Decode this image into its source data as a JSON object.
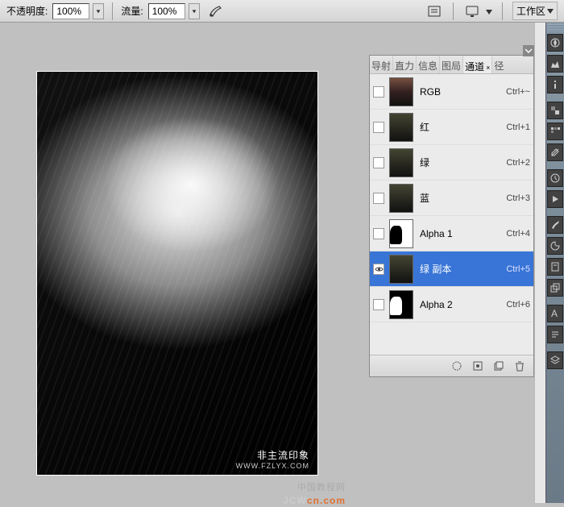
{
  "toolbar": {
    "opacity_label": "不透明度:",
    "opacity_value": "100%",
    "flow_label": "流量:",
    "flow_value": "100%",
    "workspace_label": "工作区"
  },
  "watermark": {
    "main": "非主流印象",
    "sub": "WWW.FZLYX.COM",
    "site_prefix": "中国教程网",
    "site1": "JCW",
    "site2": "cn",
    "site3": ".com"
  },
  "panel": {
    "tabs": [
      "导射",
      "直力",
      "信息",
      "图局",
      "通道",
      "径"
    ],
    "active_tab_index": 4,
    "channels": [
      {
        "name": "RGB",
        "shortcut": "Ctrl+~",
        "thumb": "rgb",
        "visible": false,
        "selected": false
      },
      {
        "name": "红",
        "shortcut": "Ctrl+1",
        "thumb": "color",
        "visible": false,
        "selected": false
      },
      {
        "name": "绿",
        "shortcut": "Ctrl+2",
        "thumb": "color",
        "visible": false,
        "selected": false
      },
      {
        "name": "蓝",
        "shortcut": "Ctrl+3",
        "thumb": "color",
        "visible": false,
        "selected": false
      },
      {
        "name": "Alpha 1",
        "shortcut": "Ctrl+4",
        "thumb": "alpha",
        "visible": false,
        "selected": false
      },
      {
        "name": "绿 副本",
        "shortcut": "Ctrl+5",
        "thumb": "color",
        "visible": true,
        "selected": true
      },
      {
        "name": "Alpha 2",
        "shortcut": "Ctrl+6",
        "thumb": "alpha2",
        "visible": false,
        "selected": false
      }
    ]
  }
}
